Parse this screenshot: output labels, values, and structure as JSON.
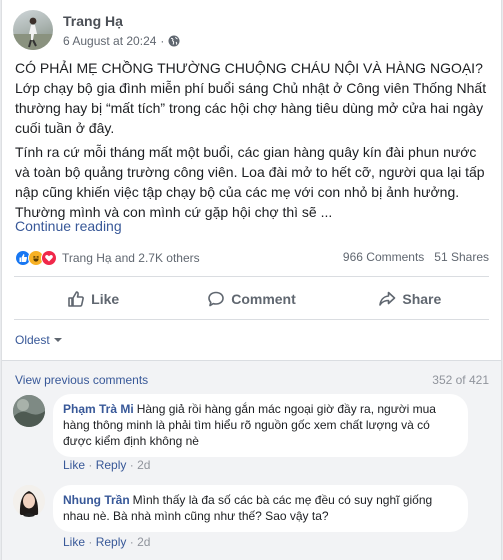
{
  "post": {
    "author": "Trang Hạ",
    "date": "6 August at 20:24",
    "separator": "·",
    "paragraph1": "CÓ PHẢI MẸ CHỒNG THƯỜNG CHUỘNG CHÁU NỘI VÀ HÀNG NGOẠI? Lớp chạy bộ gia đình miễn phí buổi sáng Chủ nhật ở Công viên Thống Nhất thường hay bị “mất tích” trong các hội chợ hàng tiêu dùng mở cửa hai ngày cuối tuần ở đây.",
    "paragraph2": "Tính ra cứ mỗi tháng mất một buổi, các gian hàng quây kín đài phun nước và toàn bộ quảng trường công viên. Loa đài mở to hết cỡ, người qua lại tấp nập cũng khiến việc tập chạy bộ của các mẹ với con nhỏ bị ảnh hưởng. Thường mình và con mình cứ gặp hội chợ thì sẽ ...",
    "continue_label": "Continue reading"
  },
  "reactions": {
    "icons": [
      "like-icon",
      "haha-icon",
      "love-icon"
    ],
    "summary": "Trang Hạ and 2.7K others",
    "comments_count": "966 Comments",
    "shares_count": "51 Shares"
  },
  "actions": {
    "like": "Like",
    "comment": "Comment",
    "share": "Share"
  },
  "comments_section": {
    "sort_label": "Oldest",
    "view_previous": "View previous comments",
    "page_count": "352 of 421",
    "items": [
      {
        "name": "Phạm Trà Mi",
        "text": "Hàng giả rồi hàng gắn mác ngoại giờ đầy ra, người mua hàng thông minh là phải tìm hiểu rõ nguồn gốc xem chất lượng và có được kiểm định không nè",
        "like": "Like",
        "reply": "Reply",
        "time": "2d"
      },
      {
        "name": "Nhung Trần",
        "text": "Mình thấy là đa số các bà các mẹ đều có suy nghĩ giống nhau nè. Bà nhà mình cũng như thế? Sao vậy ta?",
        "like": "Like",
        "reply": "Reply",
        "time": "2d"
      }
    ]
  },
  "colors": {
    "link": "#385898",
    "like_blue": "#1877f2",
    "haha_yellow": "#f7b125",
    "love_red": "#f0284a",
    "muted": "#606770"
  }
}
